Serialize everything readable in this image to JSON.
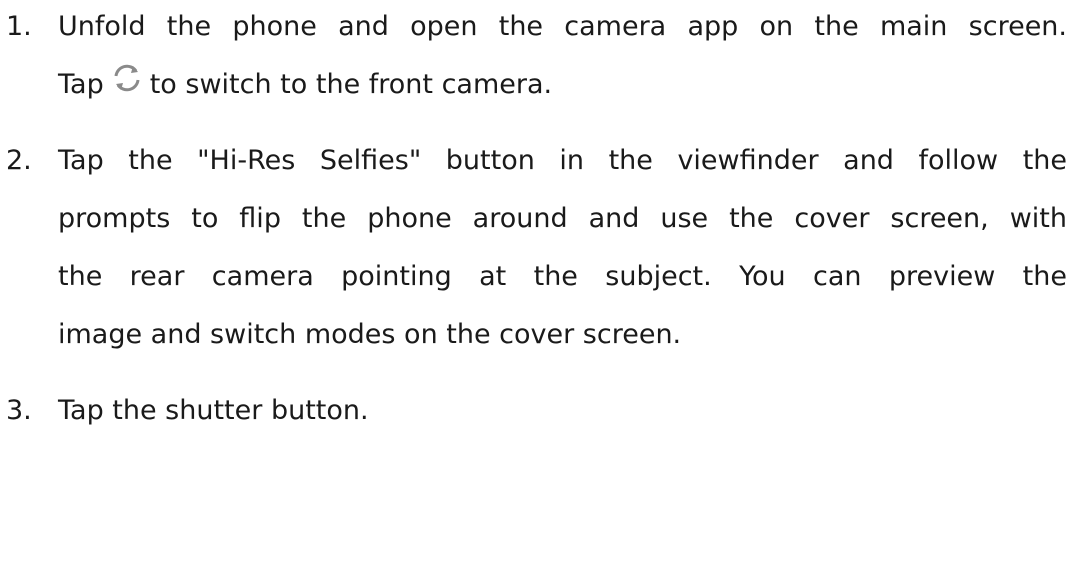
{
  "steps": [
    {
      "number": "1.",
      "text_before_icon_line1": "Unfold the phone and open the camera app on the main screen.",
      "text_before_icon": "Tap",
      "icon": "switch-camera-icon",
      "text_after_icon": "to switch to the front camera."
    },
    {
      "number": "2.",
      "lines": [
        "Tap the \"Hi-Res Selfies\" button in the viewfinder and follow the",
        "prompts to flip the phone around and use the cover screen, with",
        "the rear camera pointing at the subject. You can preview the",
        "image and switch modes on the cover screen."
      ]
    },
    {
      "number": "3.",
      "text": "Tap the shutter button."
    }
  ]
}
